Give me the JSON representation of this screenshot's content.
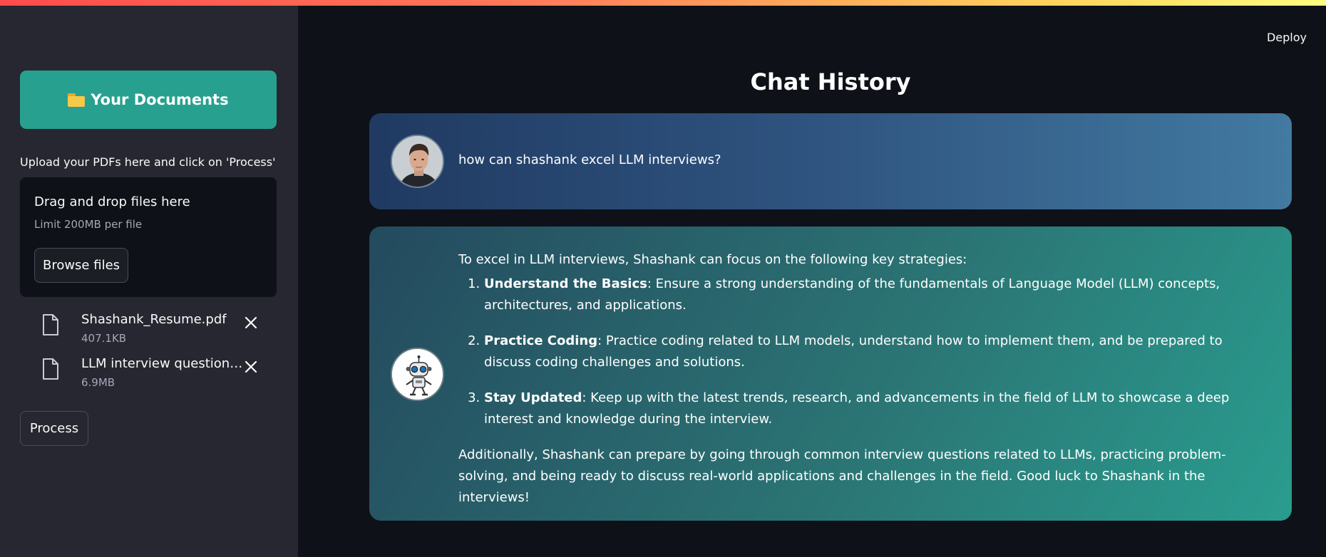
{
  "header": {
    "deploy_label": "Deploy"
  },
  "sidebar": {
    "banner_label": "Your Documents",
    "banner_icon": "folder-icon",
    "upload_instructions": "Upload your PDFs here and click on 'Process'",
    "dropzone": {
      "title": "Drag and drop files here",
      "limit": "Limit 200MB per file",
      "browse_label": "Browse files"
    },
    "files": [
      {
        "name": "Shashank_Resume.pdf",
        "size": "407.1KB"
      },
      {
        "name": "LLM interview questions.pdf",
        "size": "6.9MB"
      }
    ],
    "process_label": "Process"
  },
  "main": {
    "title": "Chat History",
    "user_message": "how can shashank excel LLM interviews?",
    "bot_message": {
      "intro": "To excel in LLM interviews, Shashank can focus on the following key strategies:",
      "items": [
        {
          "title": "Understand the Basics",
          "text": ": Ensure a strong understanding of the fundamentals of Language Model (LLM) concepts, architectures, and applications."
        },
        {
          "title": "Practice Coding",
          "text": ": Practice coding related to LLM models, understand how to implement them, and be prepared to discuss coding challenges and solutions."
        },
        {
          "title": "Stay Updated",
          "text": ": Keep up with the latest trends, research, and advancements in the field of LLM to showcase a deep interest and knowledge during the interview."
        }
      ],
      "outro": "Additionally, Shashank can prepare by going through common interview questions related to LLMs, practicing problem-solving, and being ready to discuss real-world applications and challenges in the field. Good luck to Shashank in the interviews!"
    }
  },
  "colors": {
    "sidebar_bg": "#262730",
    "main_bg": "#0e1117",
    "banner_bg": "#28a08f",
    "user_bubble": "#2f5580",
    "bot_bubble": "#2b7474"
  }
}
